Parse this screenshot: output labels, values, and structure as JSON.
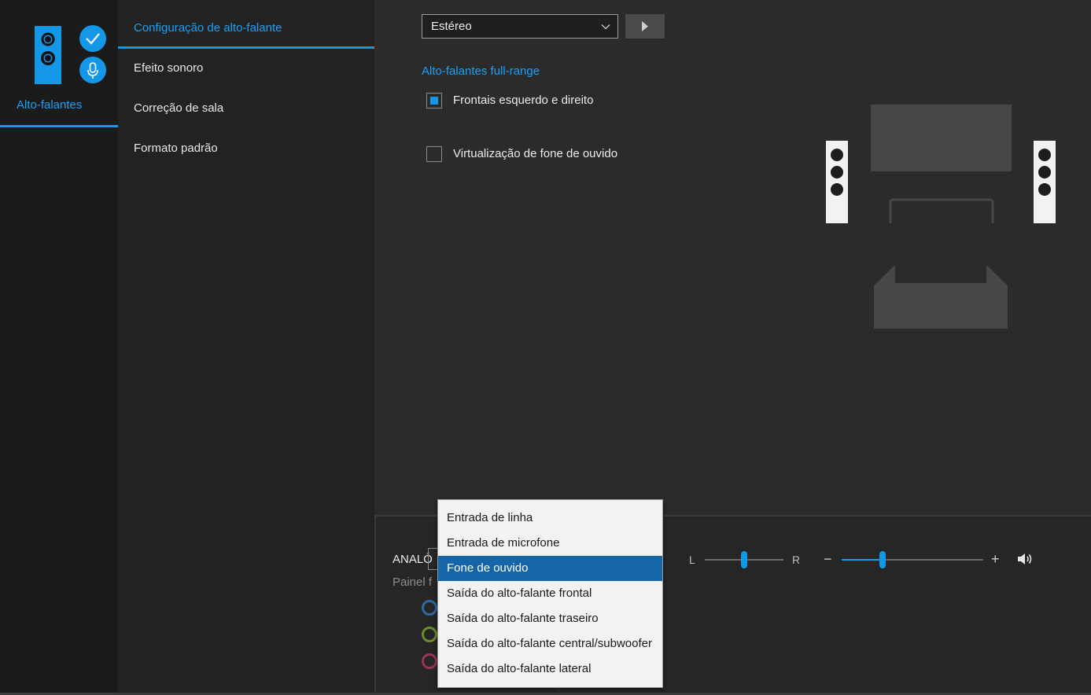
{
  "device": {
    "label": "Alto-falantes",
    "icon": "speaker-icon",
    "badges": [
      "checkmark-icon",
      "microphone-icon"
    ],
    "accent_color": "#1597e8"
  },
  "nav": {
    "items": [
      {
        "label": "Configuração de alto-falante",
        "active": true
      },
      {
        "label": "Efeito sonoro",
        "active": false
      },
      {
        "label": "Correção de sala",
        "active": false
      },
      {
        "label": "Formato padrão",
        "active": false
      }
    ]
  },
  "speaker_config": {
    "mode_value": "Estéreo",
    "play_icon": "play-icon",
    "fullrange_title": "Alto-falantes full-range",
    "options": [
      {
        "label": "Frontais esquerdo e direito",
        "checked": true
      },
      {
        "label": "Virtualização de fone de ouvido",
        "checked": false
      }
    ]
  },
  "bottom_panel": {
    "device_label": "ANALÓ",
    "panel_label": "Painel f",
    "jack_colors": [
      "#2d6a9f",
      "#6b8b2e",
      "#9a3550"
    ],
    "balance": {
      "left_label": "L",
      "right_label": "R",
      "value": 0.5
    },
    "volume": {
      "minus": "−",
      "plus": "+",
      "value": 0.29,
      "icon": "speaker-volume-icon"
    }
  },
  "jack_menu": {
    "items": [
      {
        "label": "Entrada de linha",
        "selected": false
      },
      {
        "label": "Entrada de microfone",
        "selected": false
      },
      {
        "label": "Fone de ouvido",
        "selected": true
      },
      {
        "label": "Saída do alto-falante frontal",
        "selected": false
      },
      {
        "label": "Saída do alto-falante traseiro",
        "selected": false
      },
      {
        "label": "Saída do alto-falante central/subwoofer",
        "selected": false
      },
      {
        "label": "Saída do alto-falante lateral",
        "selected": false
      }
    ]
  }
}
